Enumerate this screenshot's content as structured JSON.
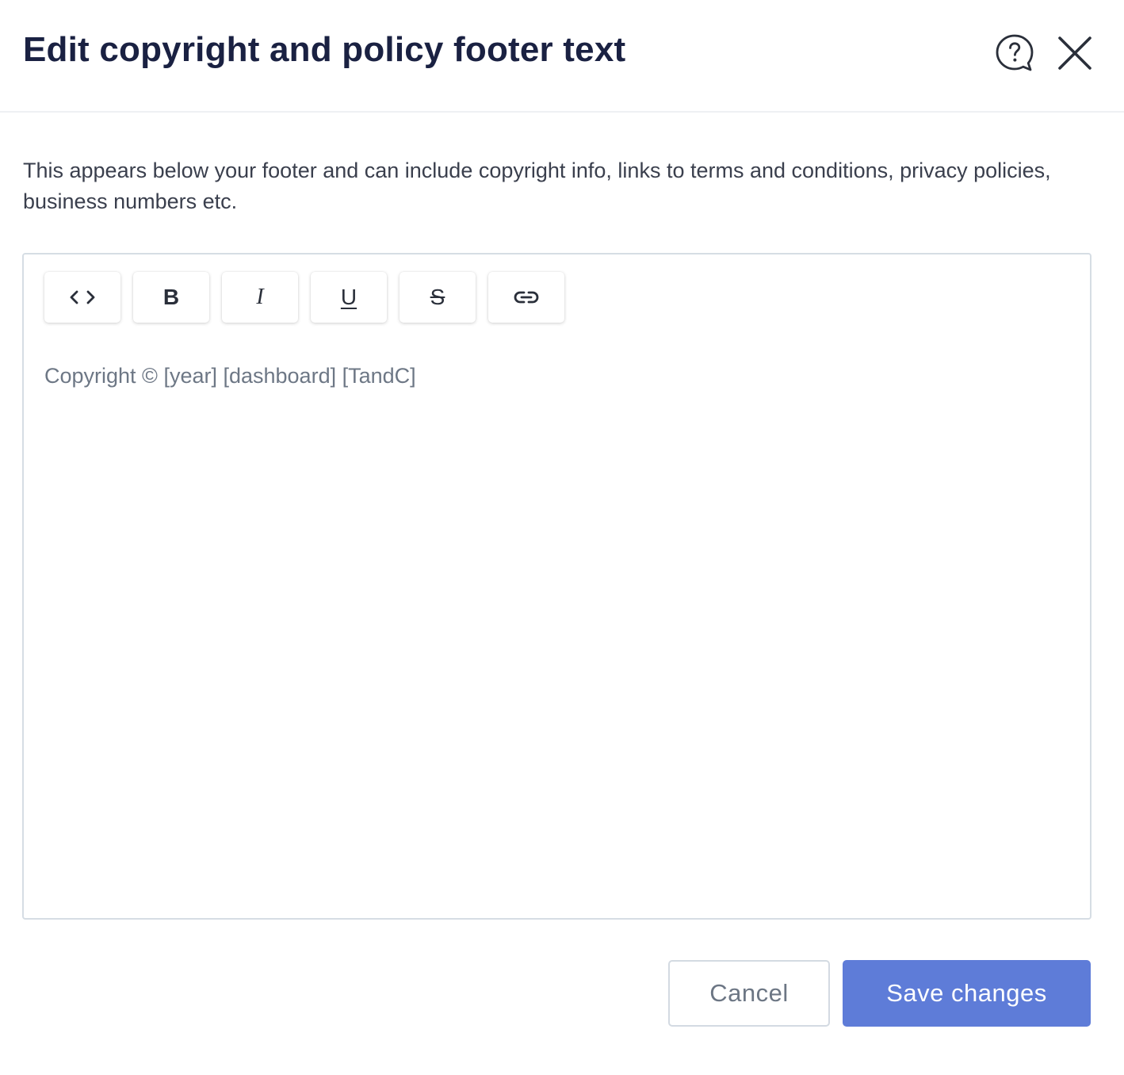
{
  "dialog": {
    "title": "Edit copyright and policy footer text",
    "help_icon": "help-chat-icon",
    "close_icon": "close-icon",
    "description": "This appears below your footer and can include copyright info, links to terms and conditions, privacy policies, business numbers etc."
  },
  "editor": {
    "toolbar": [
      {
        "name": "code-view",
        "icon": "code-icon"
      },
      {
        "name": "bold",
        "label": "B"
      },
      {
        "name": "italic",
        "label": "I"
      },
      {
        "name": "underline",
        "label": "U"
      },
      {
        "name": "strikethrough",
        "label": "S"
      },
      {
        "name": "link",
        "icon": "link-icon"
      }
    ],
    "content": "Copyright © [year] [dashboard] [TandC]"
  },
  "actions": {
    "cancel_label": "Cancel",
    "save_label": "Save changes"
  },
  "colors": {
    "title": "#1a2142",
    "primary": "#5e7cd8",
    "border": "#d6dde4",
    "placeholder_text": "#6d7785"
  }
}
